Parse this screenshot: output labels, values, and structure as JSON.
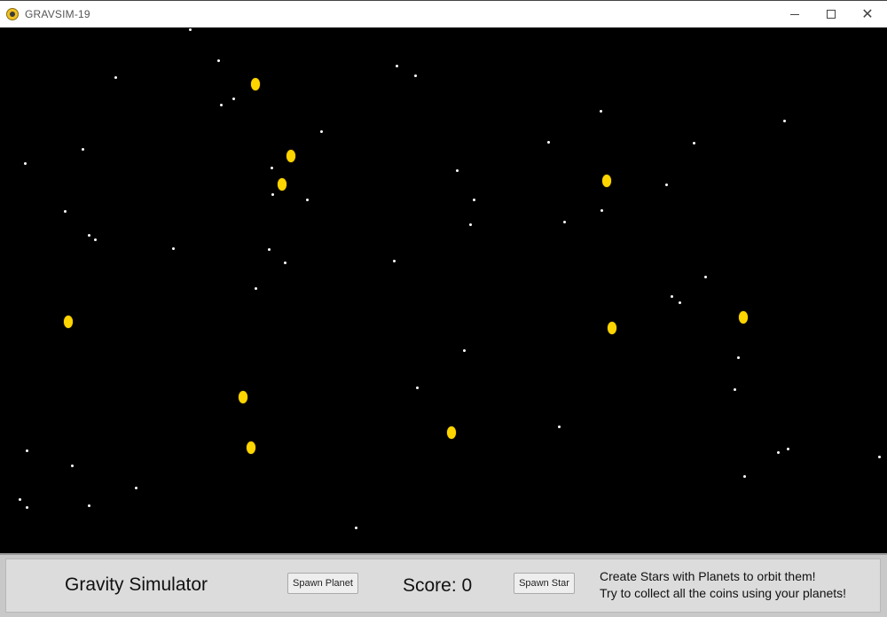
{
  "window": {
    "title": "GRAVSIM-19",
    "controls": {
      "minimize": "—",
      "close": "✕"
    }
  },
  "panel": {
    "heading": "Gravity Simulator",
    "spawn_planet_label": "Spawn Planet",
    "score_text": "Score: 0",
    "spawn_star_label": "Spawn Star",
    "instruction_line1": "Create Stars with Planets to orbit them!",
    "instruction_line2": "Try to collect all the coins using your planets!"
  },
  "colors": {
    "space": "#000000",
    "coin": "#ffd500",
    "star": "#ffffff",
    "panel": "#dcdcdc"
  }
}
